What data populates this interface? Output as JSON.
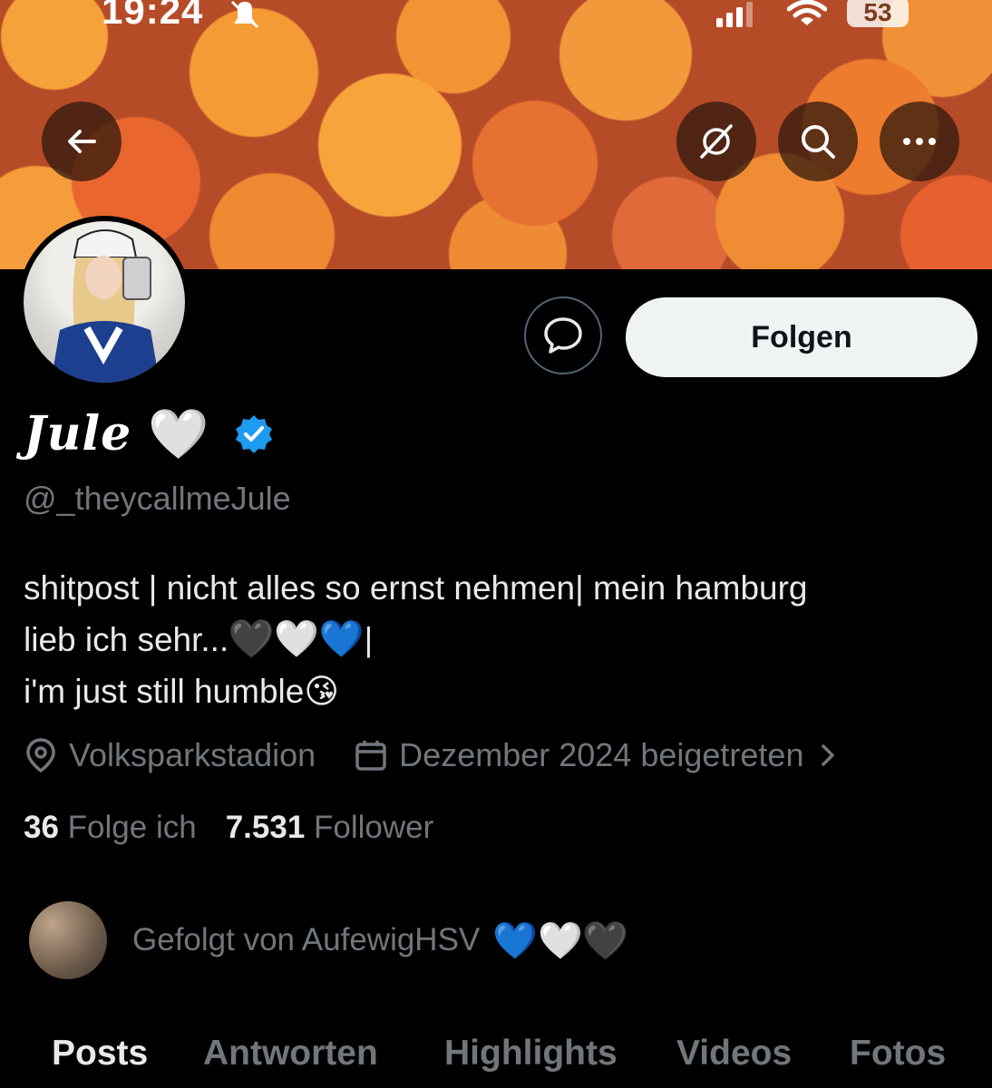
{
  "status_bar": {
    "time": "19:24",
    "battery": "53"
  },
  "header_buttons": {
    "back": "back-arrow-icon",
    "unmute": "speaker-off-icon",
    "search": "search-icon",
    "more": "more-icon"
  },
  "profile": {
    "display_name": "Jule",
    "name_heart": "🤍",
    "handle": "@_theycallmeJule",
    "verified": true,
    "bio": {
      "line1": "shitpost | nicht alles so ernst nehmen| mein hamburg",
      "line2_text": "lieb ich sehr...",
      "line2_hearts": [
        "🖤",
        "🤍",
        "💙"
      ],
      "line2_tail": "|",
      "line3_text": "i'm just still humble",
      "line3_emoji": "😘"
    },
    "location": "Volksparkstadion",
    "joined": "Dezember 2024 beigetreten",
    "following_count": "36",
    "following_label": "Folge ich",
    "followers_count": "7.531",
    "followers_label": "Follower",
    "followed_by": "Gefolgt von AufewigHSV",
    "followed_hearts": [
      "💙",
      "🤍",
      "🖤"
    ]
  },
  "actions": {
    "follow_label": "Folgen"
  },
  "tabs": [
    "Posts",
    "Antworten",
    "Highlights",
    "Videos",
    "Fotos"
  ],
  "colors": {
    "background": "#000000",
    "text": "#e7e9ea",
    "muted": "#71767b",
    "verified": "#1d9bf0",
    "follow_button": "#eff3f4"
  }
}
